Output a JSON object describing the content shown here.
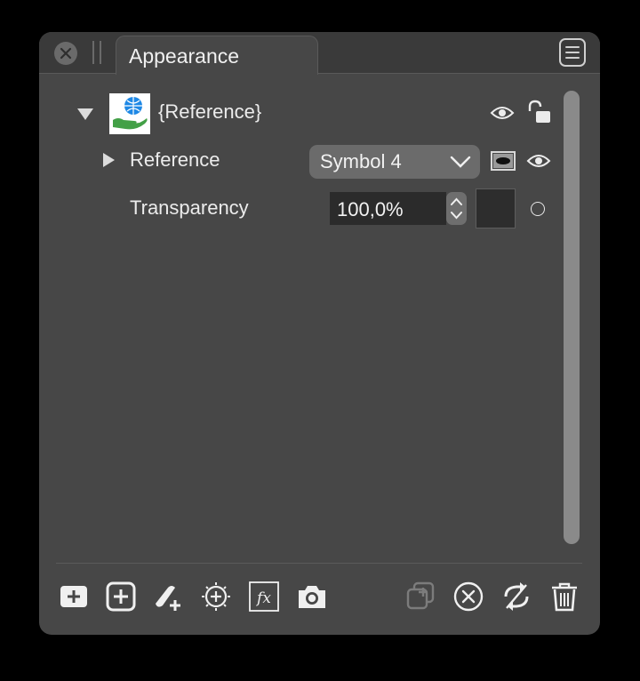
{
  "panel": {
    "tab_title": "Appearance"
  },
  "layer": {
    "name": "{Reference}"
  },
  "reference_row": {
    "label": "Reference",
    "dropdown_value": "Symbol 4"
  },
  "transparency_row": {
    "label": "Transparency",
    "value": "100,0%"
  },
  "toolbar": {
    "buttons": [
      "add-fill-icon",
      "add-stroke-icon",
      "add-brush-icon",
      "add-target-icon",
      "fx-icon",
      "camera-icon",
      "duplicate-icon",
      "remove-icon",
      "sync-icon",
      "trash-icon"
    ]
  },
  "colors": {
    "panel_bg": "#474747",
    "titlebar_bg": "#3a3a3a",
    "field_bg": "#2b2b2b",
    "dropdown_bg": "#6b6b6b"
  }
}
